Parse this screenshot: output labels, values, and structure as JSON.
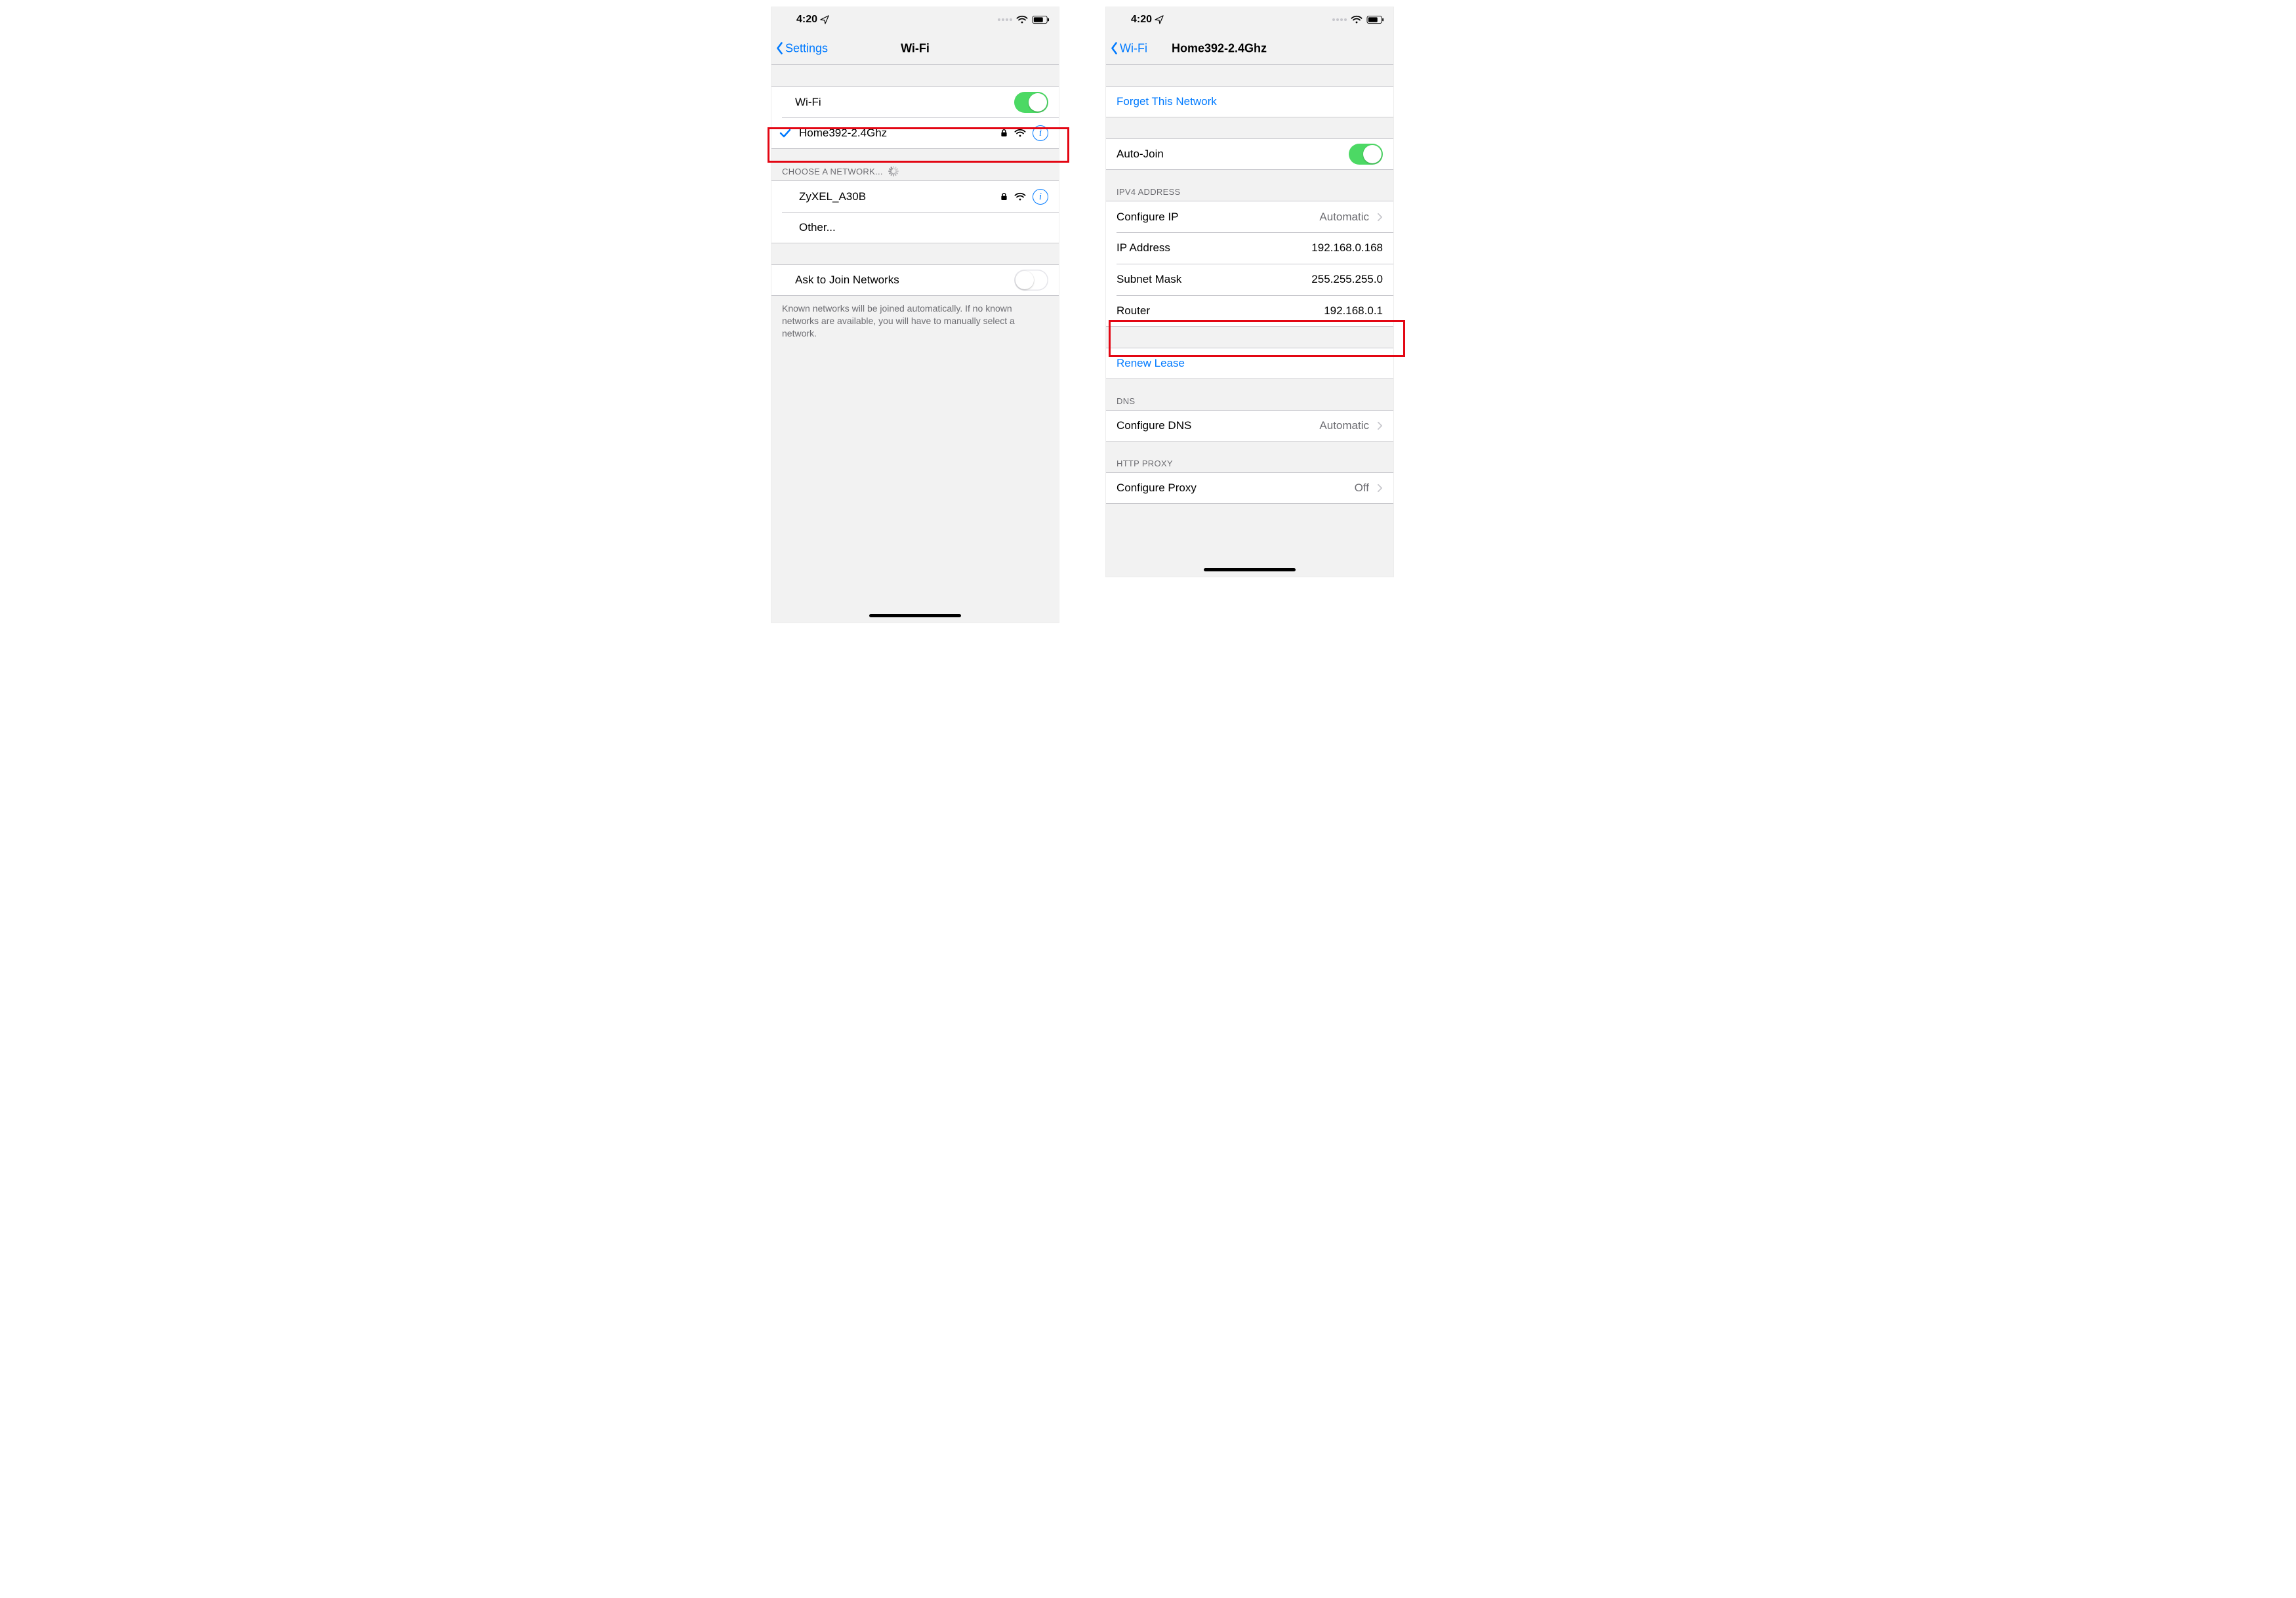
{
  "colors": {
    "link": "#007AFF",
    "green": "#4CD964",
    "highlight": "#E30613"
  },
  "statusbar": {
    "time": "4:20"
  },
  "screen1": {
    "nav": {
      "back": "Settings",
      "title": "Wi-Fi"
    },
    "wifi_row_label": "Wi-Fi",
    "connected_network": "Home392-2.4Ghz",
    "choose_header": "CHOOSE A NETWORK...",
    "other_networks": [
      "ZyXEL_A30B"
    ],
    "other_label": "Other...",
    "ask_join_label": "Ask to Join Networks",
    "ask_join_footer": "Known networks will be joined automatically. If no known networks are available, you will have to manually select a network."
  },
  "screen2": {
    "nav": {
      "back": "Wi-Fi",
      "title": "Home392-2.4Ghz"
    },
    "forget_label": "Forget This Network",
    "autojoin_label": "Auto-Join",
    "ipv4_header": "IPV4 ADDRESS",
    "rows": {
      "configure_ip": {
        "label": "Configure IP",
        "value": "Automatic"
      },
      "ip_address": {
        "label": "IP Address",
        "value": "192.168.0.168"
      },
      "subnet_mask": {
        "label": "Subnet Mask",
        "value": "255.255.255.0"
      },
      "router": {
        "label": "Router",
        "value": "192.168.0.1"
      }
    },
    "renew_label": "Renew Lease",
    "dns_header": "DNS",
    "dns_row": {
      "label": "Configure DNS",
      "value": "Automatic"
    },
    "proxy_header": "HTTP PROXY",
    "proxy_row": {
      "label": "Configure Proxy",
      "value": "Off"
    }
  }
}
